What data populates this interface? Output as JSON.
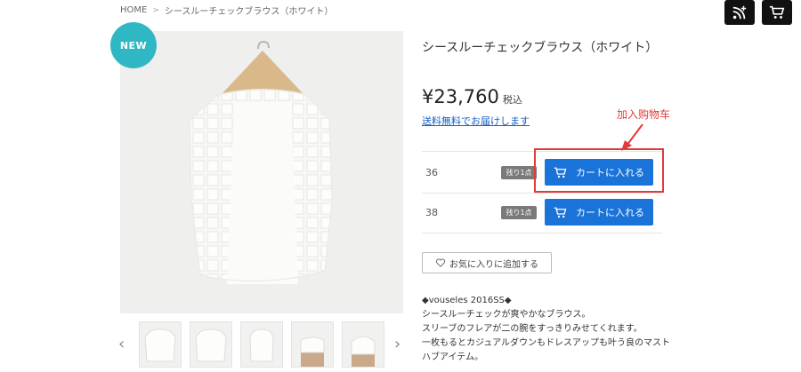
{
  "breadcrumb": {
    "home": "HOME",
    "current": "シースルーチェックブラウス（ホワイト）"
  },
  "top_buttons": {
    "rss_icon": "rss-plus-icon",
    "cart_icon": "cart-icon"
  },
  "badge": {
    "label": "NEW"
  },
  "product": {
    "title": "シースルーチェックブラウス（ホワイト）",
    "price": "¥23,760",
    "tax_label": "税込",
    "shipping": "送料無料でお届けします"
  },
  "sizes": [
    {
      "size": "36",
      "stock": "残り1点",
      "button": "カートに入れる"
    },
    {
      "size": "38",
      "stock": "残り1点",
      "button": "カートに入れる"
    }
  ],
  "favorite": {
    "label": "お気に入りに追加する",
    "icon": "heart-icon"
  },
  "description": {
    "lines": [
      "◆vouseles 2016SS◆",
      "シースルーチェックが爽やかなブラウス。",
      "スリーブのフレアが二の腕をすっきりみせてくれます。",
      "一枚もるとカジュアルダウンもドレスアップも叶う良のマスト",
      "ハブアイテム。"
    ]
  },
  "annotation": {
    "label": "加入购物车",
    "color": "#e23b3b"
  },
  "colors": {
    "accent": "#1a73d9",
    "badge": "#2fb8c4",
    "stock_tag": "#7a7a7a"
  }
}
